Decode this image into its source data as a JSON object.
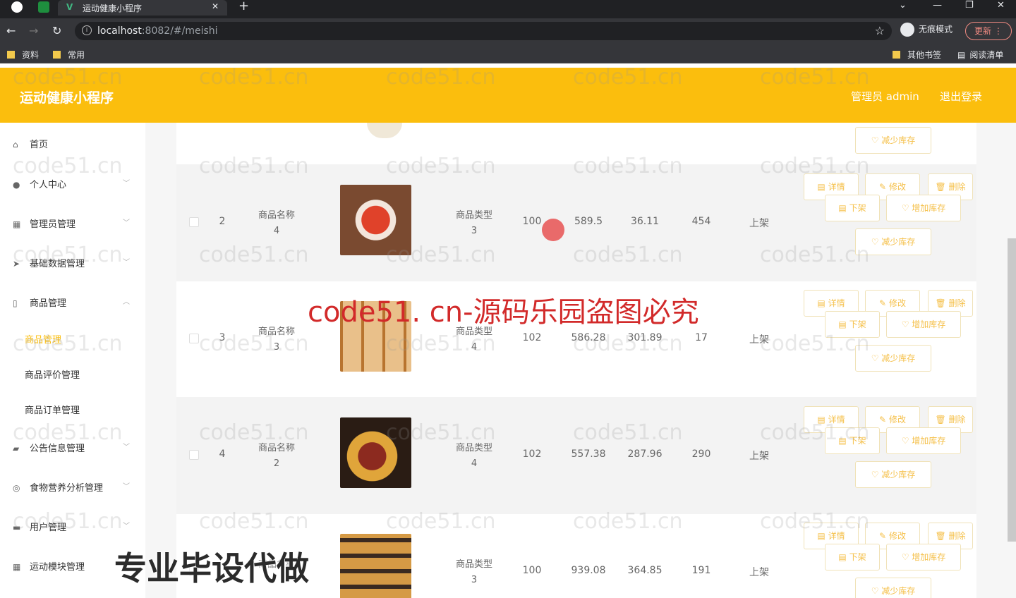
{
  "browser": {
    "tab_title": "运动健康小程序",
    "url_host": "localhost",
    "url_rest": ":8082/#/meishi",
    "incognito_label": "无痕模式",
    "update_label": "更新",
    "bookmarks": [
      "资料",
      "常用"
    ],
    "bookmarks_right": [
      "其他书签",
      "阅读清单"
    ]
  },
  "header": {
    "brand": "运动健康小程序",
    "user": "管理员 admin",
    "logout": "退出登录"
  },
  "sidebar": {
    "items": [
      {
        "label": "首页",
        "icon": "home-icon"
      },
      {
        "label": "个人中心",
        "icon": "user-icon"
      },
      {
        "label": "管理员管理",
        "icon": "grid-icon"
      },
      {
        "label": "基础数据管理",
        "icon": "send-icon"
      },
      {
        "label": "商品管理",
        "icon": "phone-icon"
      }
    ],
    "subitems": [
      "商品管理",
      "商品评价管理",
      "商品订单管理"
    ],
    "items2": [
      {
        "label": "公告信息管理",
        "icon": "briefcase-icon"
      },
      {
        "label": "食物营养分析管理",
        "icon": "compass-icon"
      },
      {
        "label": "用户管理",
        "icon": "chat-icon"
      },
      {
        "label": "运动模块管理",
        "icon": "grid-icon"
      }
    ]
  },
  "buttons": {
    "detail": "详情",
    "edit": "修改",
    "delete": "删除",
    "down": "下架",
    "add_stock": "增加库存",
    "reduce_stock": "减少库存"
  },
  "table": {
    "rows": [
      {
        "index": "2",
        "name_label": "商品名称",
        "name_value": "4",
        "type_label": "商品类型",
        "type_value": "3",
        "c1": "100",
        "c2": "589.5",
        "c3": "36.11",
        "c4": "454",
        "status": "上架"
      },
      {
        "index": "3",
        "name_label": "商品名称",
        "name_value": "3",
        "type_label": "商品类型",
        "type_value": "4",
        "c1": "102",
        "c2": "586.28",
        "c3": "301.89",
        "c4": "17",
        "status": "上架"
      },
      {
        "index": "4",
        "name_label": "商品名称",
        "name_value": "2",
        "type_label": "商品类型",
        "type_value": "4",
        "c1": "102",
        "c2": "557.38",
        "c3": "287.96",
        "c4": "290",
        "status": "上架"
      },
      {
        "index": "",
        "name_label": "商品名称",
        "name_value": "",
        "type_label": "商品类型",
        "type_value": "3",
        "c1": "100",
        "c2": "939.08",
        "c3": "364.85",
        "c4": "191",
        "status": "上架"
      }
    ]
  },
  "watermarks": {
    "grey": "code51.cn",
    "red": "code51. cn-源码乐园盗图必究",
    "black": "专业毕设代做"
  },
  "colors": {
    "accent": "#fbbe0d"
  }
}
